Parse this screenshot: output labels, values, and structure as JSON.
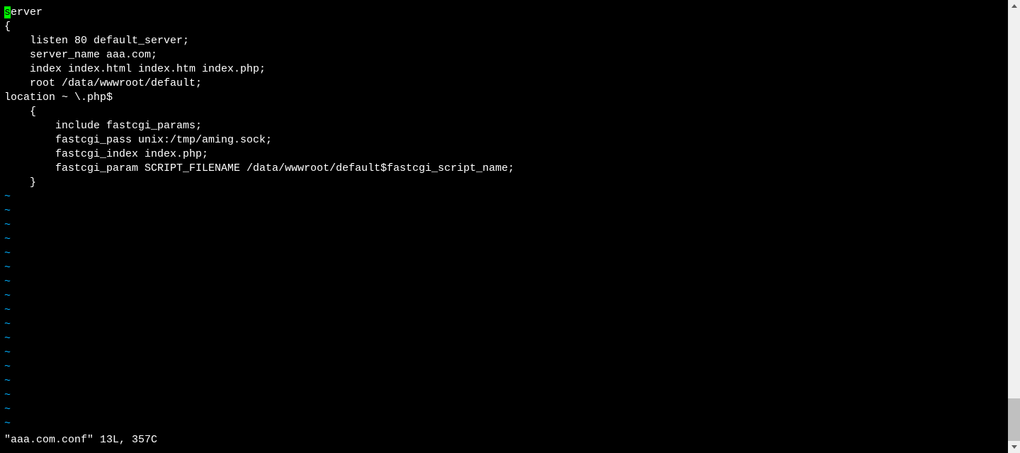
{
  "editor": {
    "cursor_char": "s",
    "lines": [
      "erver",
      "{",
      "    listen 80 default_server;",
      "    server_name aaa.com;",
      "    index index.html index.htm index.php;",
      "    root /data/wwwroot/default;",
      "location ~ \\.php$",
      "    {",
      "        include fastcgi_params;",
      "        fastcgi_pass unix:/tmp/aming.sock;",
      "        fastcgi_index index.php;",
      "        fastcgi_param SCRIPT_FILENAME /data/wwwroot/default$fastcgi_script_name;",
      "    }"
    ],
    "tilde": "~",
    "tilde_count": 17,
    "status": "\"aaa.com.conf\" 13L, 357C"
  }
}
